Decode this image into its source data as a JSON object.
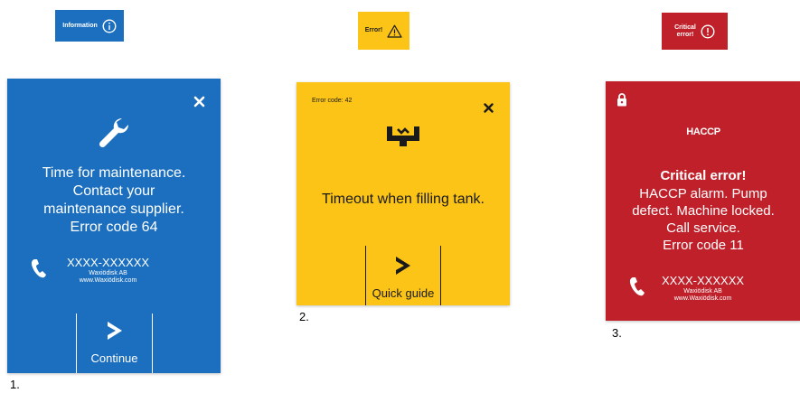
{
  "badges": {
    "information": {
      "label": "Information",
      "bg": "#1c6fbf"
    },
    "error": {
      "label": "Error!",
      "bg": "#fbc416"
    },
    "critical": {
      "label": "Critical\nerror!",
      "bg": "#c0202a"
    }
  },
  "cards": {
    "maintenance": {
      "message": "Time for maintenance.\nContact your\nmaintenance supplier.\nError code 64",
      "phone": "XXXX-XXXXXX",
      "company": "Waxiödisk AB",
      "website": "www.Waxiödisk.com",
      "action_label": "Continue",
      "caption": "1.",
      "icon": "wrench-icon"
    },
    "timeout": {
      "error_code": "Error code: 42",
      "message": "Timeout when filling tank.",
      "action_label": "Quick guide",
      "caption": "2.",
      "icon": "tank-fill-icon"
    },
    "critical": {
      "logo": "HACCP",
      "title": "Critical error!",
      "message": "HACCP alarm. Pump\ndefect. Machine locked.\nCall service.\nError code 11",
      "phone": "XXXX-XXXXXX",
      "company": "Waxiödisk AB",
      "website": "www.Waxiödisk.com",
      "caption": "3.",
      "icon": "lock-icon"
    }
  },
  "colors": {
    "info": "#1c6fbf",
    "warning": "#fbc416",
    "critical": "#c0202a"
  }
}
